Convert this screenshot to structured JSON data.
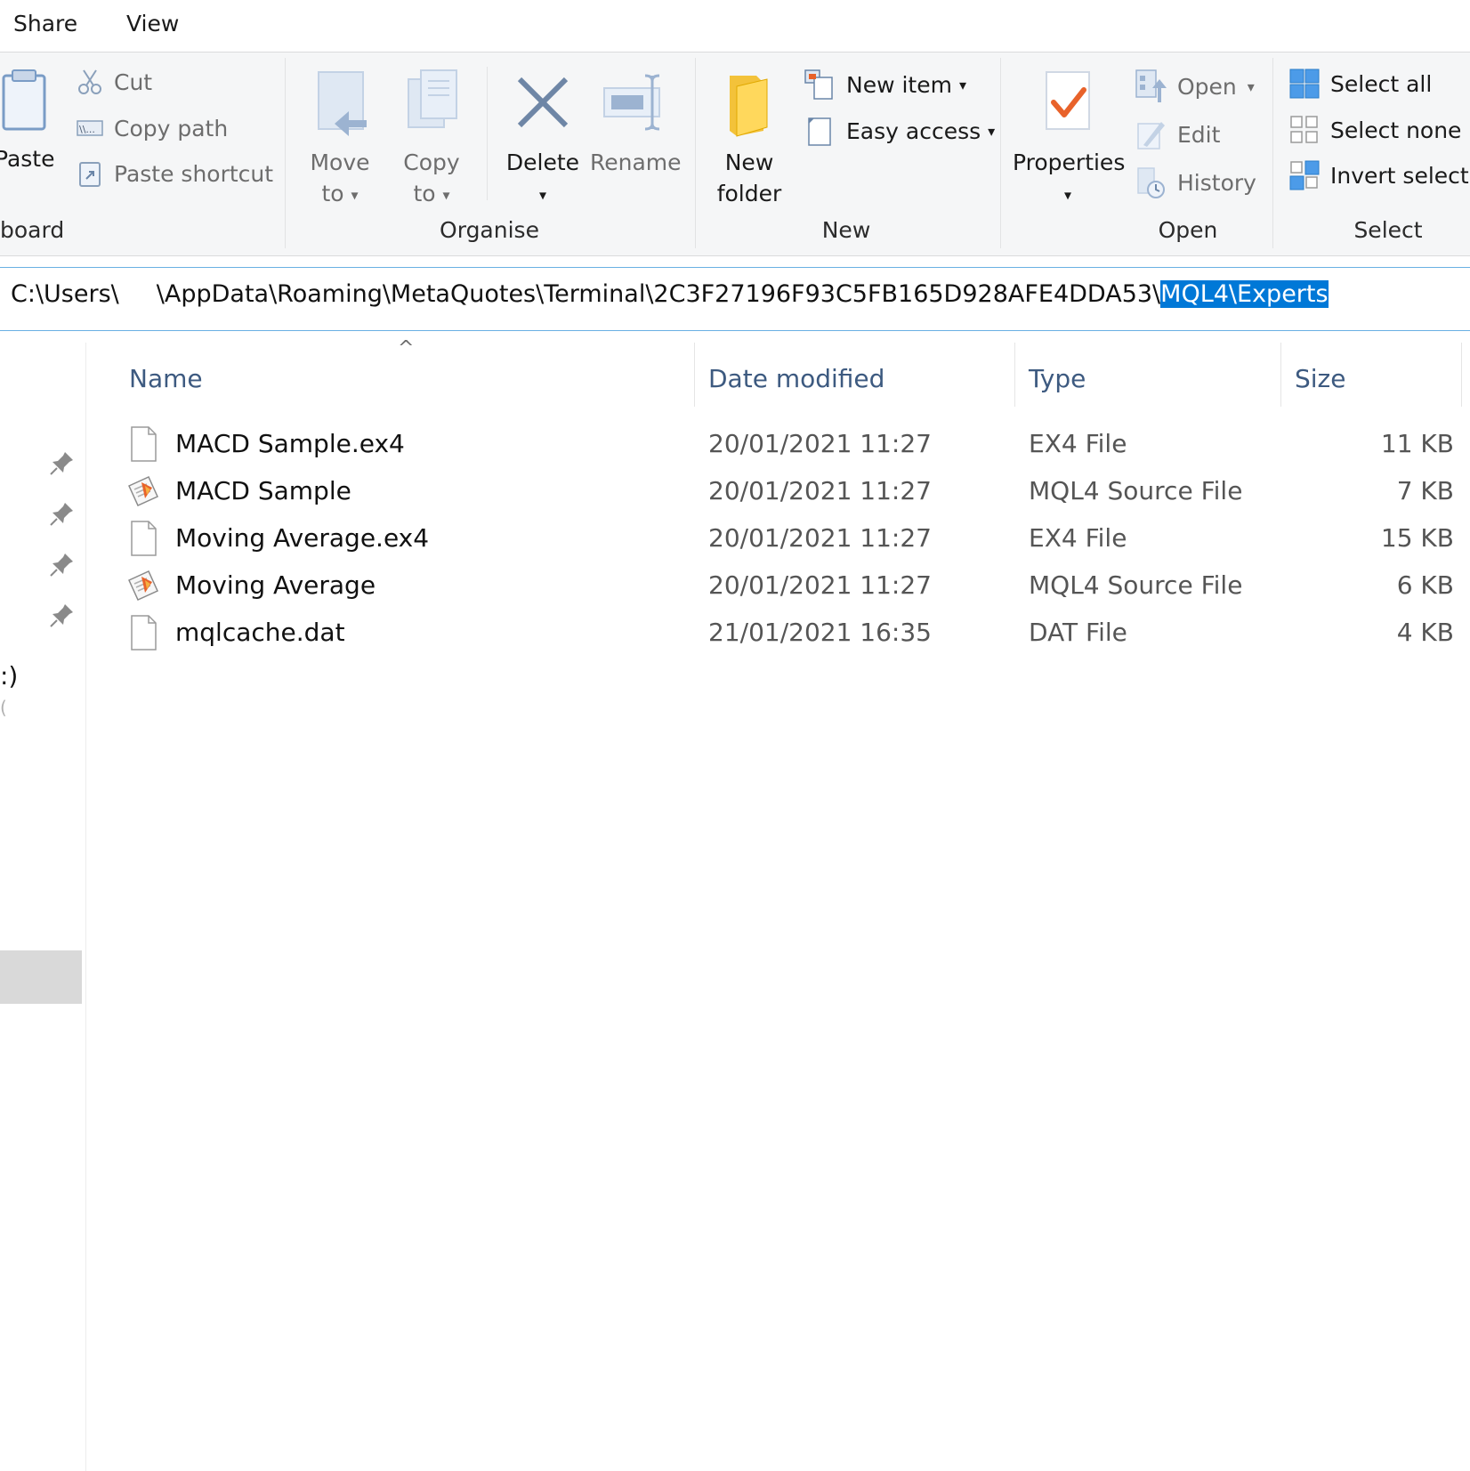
{
  "tabs": [
    {
      "label": "Share"
    },
    {
      "label": "View"
    }
  ],
  "ribbon": {
    "clipboard": {
      "paste_label": "Paste",
      "cut_label": "Cut",
      "copy_path_label": "Copy path",
      "paste_shortcut_label": "Paste shortcut",
      "group_label": "board"
    },
    "organise": {
      "move_to_line1": "Move",
      "move_to_line2": "to",
      "copy_to_line1": "Copy",
      "copy_to_line2": "to",
      "delete_label": "Delete",
      "rename_label": "Rename",
      "group_label": "Organise"
    },
    "new": {
      "new_folder_line1": "New",
      "new_folder_line2": "folder",
      "new_item_label": "New item",
      "easy_access_label": "Easy access",
      "group_label": "New"
    },
    "open": {
      "properties_label": "Properties",
      "open_label": "Open",
      "edit_label": "Edit",
      "history_label": "History",
      "group_label": "Open"
    },
    "select": {
      "select_all_label": "Select all",
      "select_none_label": "Select none",
      "invert_selection_label": "Invert selectic",
      "group_label": "Select"
    }
  },
  "address": {
    "path_prefix": "C:\\Users\\",
    "path_middle": "\\AppData\\Roaming\\MetaQuotes\\Terminal\\2C3F27196F93C5FB165D928AFE4DDA53\\",
    "path_selected": "MQL4\\Experts"
  },
  "nav": {
    "fragment_1": ":)",
    "fragment_2": "("
  },
  "columns": {
    "name": "Name",
    "date_modified": "Date modified",
    "type": "Type",
    "size": "Size"
  },
  "files": [
    {
      "name": "MACD Sample.ex4",
      "date": "20/01/2021 11:27",
      "type": "EX4 File",
      "size": "11 KB",
      "icon": "blank-file-icon"
    },
    {
      "name": "MACD Sample",
      "date": "20/01/2021 11:27",
      "type": "MQL4 Source File",
      "size": "7 KB",
      "icon": "mql4-source-icon"
    },
    {
      "name": "Moving Average.ex4",
      "date": "20/01/2021 11:27",
      "type": "EX4 File",
      "size": "15 KB",
      "icon": "blank-file-icon"
    },
    {
      "name": "Moving Average",
      "date": "20/01/2021 11:27",
      "type": "MQL4 Source File",
      "size": "6 KB",
      "icon": "mql4-source-icon"
    },
    {
      "name": "mqlcache.dat",
      "date": "21/01/2021 16:35",
      "type": "DAT File",
      "size": "4 KB",
      "icon": "blank-file-icon"
    }
  ],
  "colors": {
    "accent": "#0078d7",
    "ribbon_bg": "#f5f6f7",
    "header_text": "#3d5a80",
    "mql_orange": "#e8622a"
  }
}
